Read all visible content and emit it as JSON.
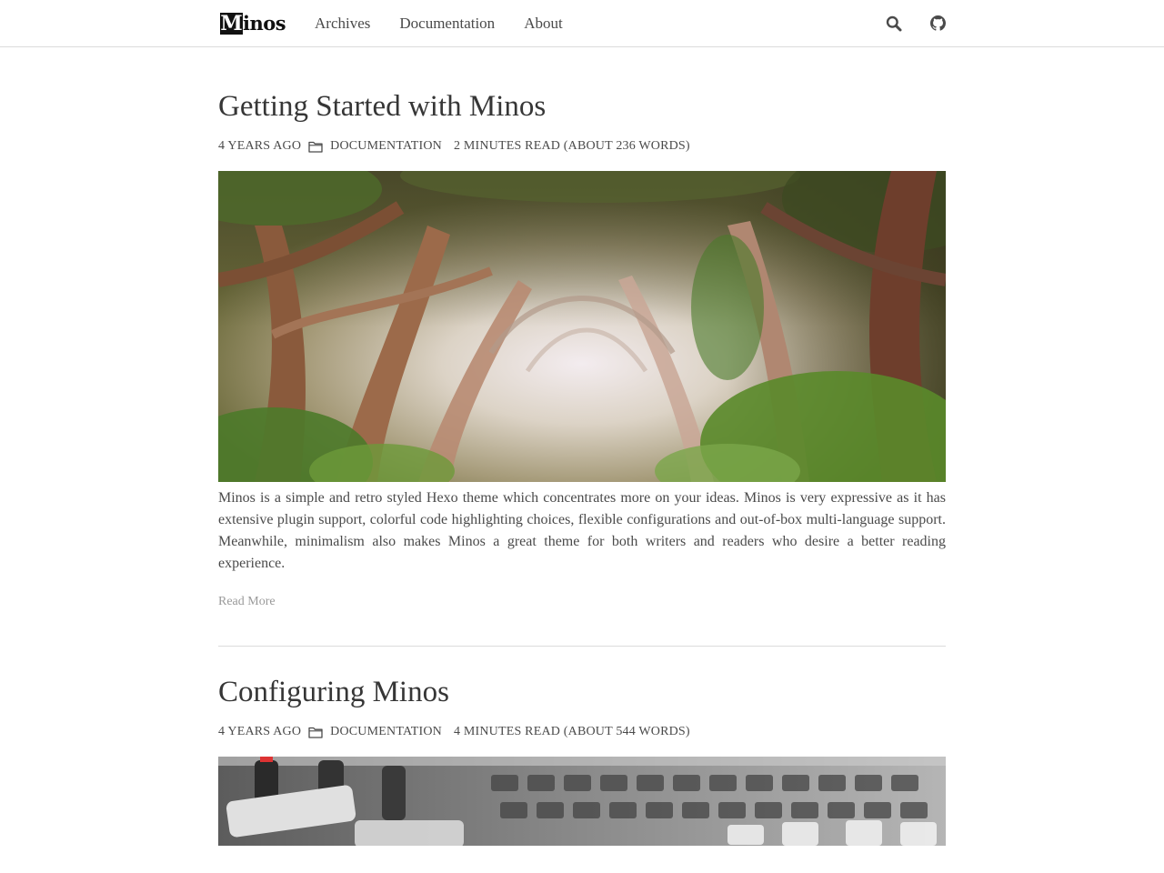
{
  "navbar": {
    "logo_letter": "M",
    "logo_text": "inos",
    "links": [
      "Archives",
      "Documentation",
      "About"
    ],
    "icons": [
      "search-icon",
      "github-icon"
    ]
  },
  "articles": [
    {
      "title": "Getting Started with Minos",
      "date": "4 years ago",
      "category": "Documentation",
      "read_time": "2 minutes read (About 236 words)",
      "image": "forest-tree-tunnel",
      "excerpt": "Minos is a simple and retro styled Hexo theme which concentrates more on your ideas. Minos is very expressive as it has extensive plugin support, colorful code highlighting choices, flexible configurations and out-of-box multi-language support. Meanwhile, minimalism also makes Minos a great theme for both writers and readers who desire a better reading experience.",
      "read_more": "Read More"
    },
    {
      "title": "Configuring Minos",
      "date": "4 years ago",
      "category": "Documentation",
      "read_time": "4 minutes read (About 544 words)",
      "image": "audio-mixer-closeup"
    }
  ],
  "colors": {
    "text": "#4a4a4a",
    "title": "#363636",
    "border": "#dbdbdb",
    "muted": "#9a9a9a"
  }
}
